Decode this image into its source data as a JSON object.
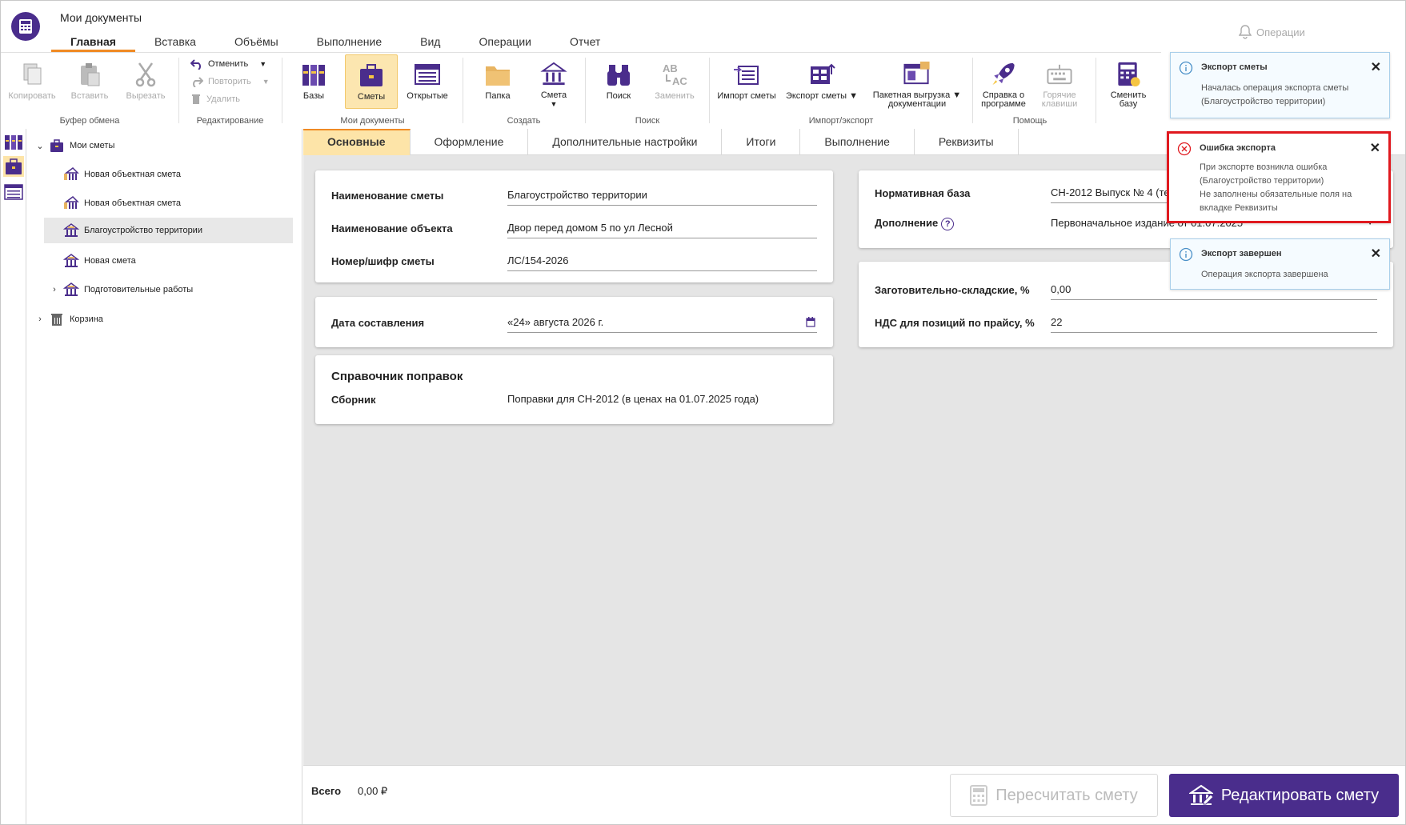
{
  "app": {
    "title": "Мои документы"
  },
  "menu": [
    "Главная",
    "Вставка",
    "Объёмы",
    "Выполнение",
    "Вид",
    "Операции",
    "Отчет"
  ],
  "operations_label": "Операции",
  "ribbon": {
    "clipboard": {
      "copy": "Копировать",
      "paste": "Вставить",
      "cut": "Вырезать",
      "label": "Буфер обмена"
    },
    "edit": {
      "undo": "Отменить",
      "redo": "Повторить",
      "delete": "Удалить",
      "label": "Редактирование"
    },
    "mydocs": {
      "bases": "Базы",
      "estimates": "Сметы",
      "open": "Открытые",
      "label": "Мои документы"
    },
    "create": {
      "folder": "Папка",
      "estimate": "Смета",
      "label": "Создать"
    },
    "search": {
      "find": "Поиск",
      "replace": "Заменить",
      "label": "Поиск"
    },
    "impexp": {
      "import": "Импорт сметы",
      "export": "Экспорт сметы",
      "batch1": "Пакетная выгрузка",
      "batch2": "документации",
      "label": "Импорт/экспорт"
    },
    "help": {
      "about1": "Справка о",
      "about2": "программе",
      "hotkeys1": "Горячие",
      "hotkeys2": "клавиши",
      "label": "Помощь"
    },
    "change_base": {
      "l1": "Сменить",
      "l2": "базу"
    }
  },
  "tree": {
    "root": "Мои сметы",
    "items": [
      "Новая объектная смета",
      "Новая объектная смета",
      "Благоустройство территории",
      "Новая смета",
      "Подготовительные работы"
    ],
    "trash": "Корзина"
  },
  "tabs": [
    "Основные",
    "Оформление",
    "Дополнительные настройки",
    "Итоги",
    "Выполнение",
    "Реквизиты"
  ],
  "form": {
    "name_label": "Наименование сметы",
    "name_value": "Благоустройство территории",
    "object_label": "Наименование объекта",
    "object_value": "Двор перед домом 5 по ул Лесной",
    "code_label": "Номер/шифр сметы",
    "code_value": "ЛС/154-2026",
    "date_label": "Дата составления",
    "date_value": "«24» августа 2026 г.",
    "ref_title": "Справочник поправок",
    "coll_label": "Сборник",
    "coll_value": "Поправки для СН-2012 (в ценах на 01.07.2025 года)",
    "base_label": "Нормативная база",
    "base_value": "СН-2012 Выпуск № 4 (текущая)",
    "add_label": "Дополнение",
    "add_value": "Первоначальное издание от 01.07.2025",
    "storage_label": "Заготовительно-складские, %",
    "storage_value": "0,00",
    "vat_label": "НДС для позиций по прайсу, %",
    "vat_value": "22"
  },
  "footer": {
    "total_label": "Всего",
    "total_value": "0,00 ₽",
    "recalc": "Пересчитать смету",
    "edit": "Редактировать смету"
  },
  "notifications": [
    {
      "title": "Экспорт сметы",
      "text": "Началась операция экспорта сметы (Благоустройство территории)",
      "type": "info"
    },
    {
      "title": "Ошибка экспорта",
      "text1": "При экспорте возникла ошибка (Благоустройство территории)",
      "text2": "Не заполнены обязательные поля на вкладке Реквизиты",
      "type": "error"
    },
    {
      "title": "Экспорт завершен",
      "text": "Операция экспорта завершена",
      "type": "info"
    }
  ],
  "colors": {
    "accent": "#4a2d8c",
    "tab_active": "#fde4a8",
    "underline": "#f08a24",
    "error": "#e0191f"
  }
}
